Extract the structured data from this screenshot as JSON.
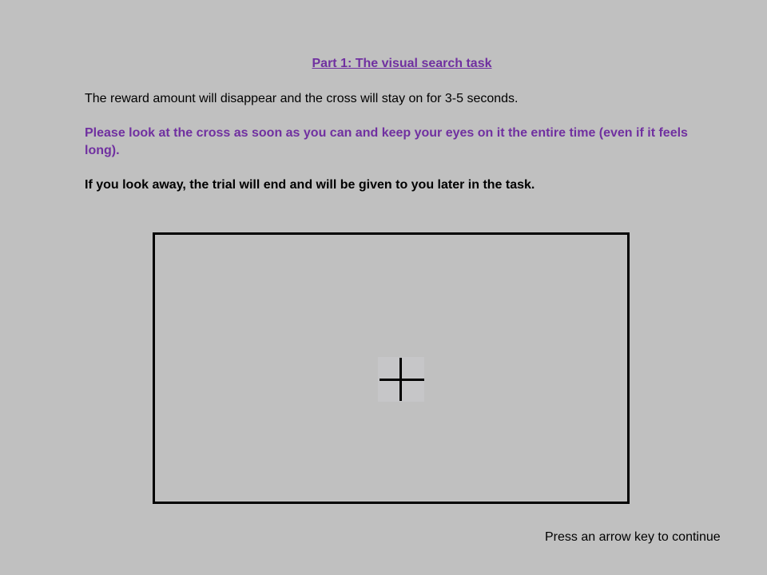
{
  "title": "Part 1: The visual search task",
  "instructions": {
    "line1": "The reward amount will disappear and the cross will stay on for 3-5 seconds.",
    "line2": "Please look at the cross as soon as you can and keep your eyes on it the entire time (even if it feels long).",
    "line3": "If you look away, the trial will end and will be given to you later in the task."
  },
  "footer": {
    "continue_prompt": "Press an arrow key to continue"
  },
  "colors": {
    "background": "#c0c0c0",
    "accent": "#7030a0",
    "text": "#000000"
  },
  "icons": {
    "fixation": "fixation-cross-icon"
  }
}
